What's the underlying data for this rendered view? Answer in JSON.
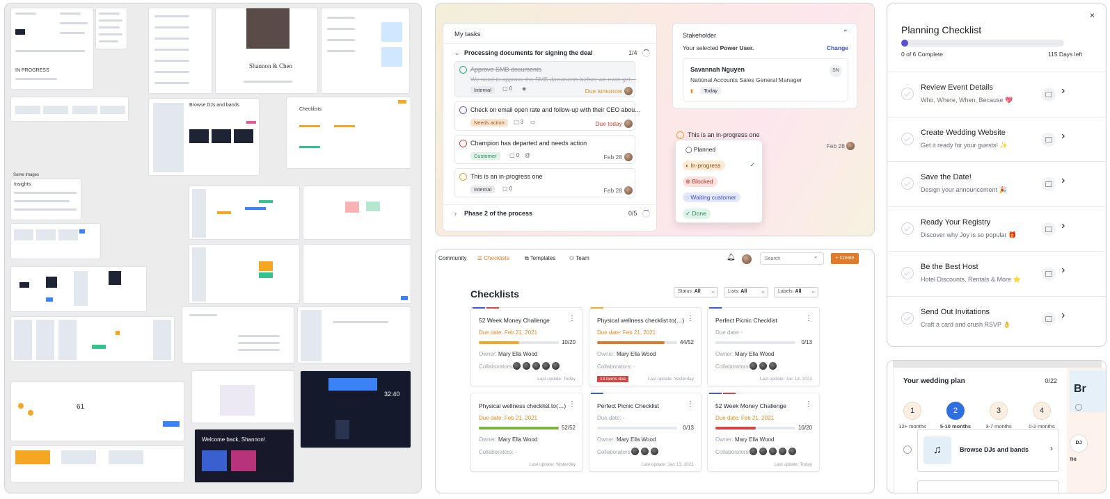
{
  "tasks_panel": {
    "header": "My tasks",
    "group1": {
      "title": "Processing documents for signing the deal",
      "count": "1/4"
    },
    "tasks": [
      {
        "title": "Approve SMB documents",
        "subtitle": "We need to approve the SMB documents before we even get…",
        "tag": "Internal",
        "comments": "0",
        "due": "Due tomorrow",
        "status": "done"
      },
      {
        "title": "Check on email open rate and follow-up with their CEO abou…",
        "subtitle": "",
        "tag": "Needs action",
        "comments": "3",
        "due": "Due today",
        "status": "waiting"
      },
      {
        "title": "Champion has departed and needs action",
        "subtitle": "",
        "tag": "Customer",
        "comments": "0",
        "due": "Feb 28",
        "status": "blocked"
      },
      {
        "title": "This is an in-progress one",
        "subtitle": "",
        "tag": "Internal",
        "comments": "0",
        "due": "Feb 28",
        "status": "in-progress"
      }
    ],
    "group2": {
      "title": "Phase 2 of the process",
      "count": "0/5"
    },
    "stakeholder": {
      "header": "Stakeholder",
      "selected_prefix": "Your selected ",
      "selected_role": "Power User.",
      "change": "Change",
      "name": "Savannah Nguyen",
      "initials": "SN",
      "role": "National Accounts Sales General Manager",
      "date": "Today"
    },
    "inprogress_card": {
      "title": "This is an in-progress one",
      "due": "Feb 28"
    },
    "status_menu": {
      "items": [
        "Planned",
        "In-progress",
        "Blocked",
        "Waiting customer",
        "Done"
      ],
      "selected": "In-progress"
    }
  },
  "checklists_panel": {
    "nav": {
      "community": "Community",
      "checklists": "Checklists",
      "templates": "Templates",
      "team": "Team",
      "search_placeholder": "Search",
      "create": "+ Create"
    },
    "title": "Checklists",
    "filters": [
      {
        "label": "Status:",
        "value": "All"
      },
      {
        "label": "Lists:",
        "value": "All"
      },
      {
        "label": "Labels:",
        "value": "All"
      }
    ],
    "owner_label": "Owner:",
    "collab_label": "Collaborators:",
    "cards": [
      {
        "title": "52 Week Money Challenge",
        "due": "Due date: Feb 21, 2021",
        "progress": "10/20",
        "fraction": 0.5,
        "owner": "Mary Ella Wood",
        "collab": "",
        "updated": "Last update: Today",
        "alert": "",
        "color": "#f5a623"
      },
      {
        "title": "Physical wellness checklist to(…)",
        "due": "Due date: Feb 21, 2021",
        "progress": "44/52",
        "fraction": 0.846,
        "owner": "Mary Ella Wood",
        "collab": "-",
        "updated": "Last update: Yesterday",
        "alert": "13 items due",
        "color": "#e07b2a"
      },
      {
        "title": "Perfect Picnic Checklist",
        "due": "Due date: -",
        "progress": "0/13",
        "fraction": 0,
        "owner": "Mary Ella Wood",
        "collab": "",
        "updated": "Last update: Jan 13, 2021",
        "alert": "",
        "color": "#e07b2a"
      },
      {
        "title": "Physical wellness checklist to(…)",
        "due": "Due date: Feb 21, 2021",
        "progress": "52/52",
        "fraction": 1,
        "owner": "Mary Ella Wood",
        "collab": "-",
        "updated": "Last update: Yesterday",
        "alert": "",
        "color": "#7cb342"
      },
      {
        "title": "Perfect Picnic Checklist",
        "due": "Due date: -",
        "progress": "0/13",
        "fraction": 0,
        "owner": "Mary Ella Wood",
        "collab": "",
        "updated": "Last update: Jan 13, 2021",
        "alert": "",
        "color": "#e07b2a"
      },
      {
        "title": "52 Week Money Challenge",
        "due": "Due date: Feb 21, 2021",
        "progress": "10/20",
        "fraction": 0.5,
        "owner": "Mary Ella Wood",
        "collab": "",
        "updated": "Last update: Today",
        "alert": "",
        "color": "#d64545"
      }
    ]
  },
  "planning_panel": {
    "title": "Planning Checklist",
    "complete": "0 of 6 Complete",
    "days_left": "115 Days left",
    "items": [
      {
        "title": "Review Event Details",
        "subtitle": "Who, Where, When, Because 💖"
      },
      {
        "title": "Create Wedding Website",
        "subtitle": "Get it ready for your guests! ✨"
      },
      {
        "title": "Save the Date!",
        "subtitle": "Design your announcement 🎉"
      },
      {
        "title": "Ready Your Registry",
        "subtitle": "Discover why Joy is so popular 🎁"
      },
      {
        "title": "Be the Best Host",
        "subtitle": "Hotel Discounts, Rentals & More ⭐"
      },
      {
        "title": "Send Out Invitations",
        "subtitle": "Craft a card and crush RSVP 👌"
      }
    ]
  },
  "wedding_panel": {
    "title": "Your wedding plan",
    "count": "0/22",
    "steps": [
      {
        "num": "1",
        "label": "12+ months"
      },
      {
        "num": "2",
        "label": "5-10 months"
      },
      {
        "num": "3",
        "label": "3-7 months"
      },
      {
        "num": "4",
        "label": "0-2 months"
      }
    ],
    "item": "Browse DJs and bands",
    "peek": "Br"
  },
  "canvas": {
    "couple_names": "Shannon & Chen",
    "welcome": "Welcome back, Shannon!",
    "browse": "Browse DJs and bands",
    "checklists": "Checklists",
    "in_progress": "IN PROGRESS",
    "some_images": "Some Images",
    "insights": "Insights",
    "clock": "32:40"
  }
}
